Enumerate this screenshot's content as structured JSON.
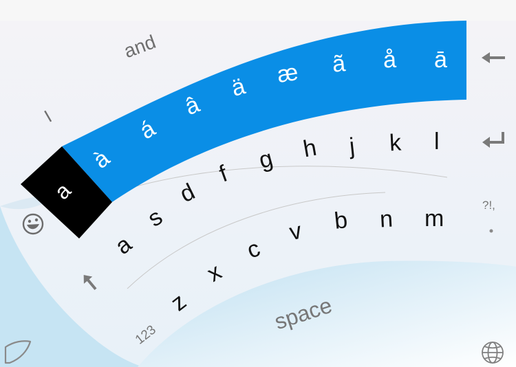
{
  "suggestions": [
    "I",
    "and"
  ],
  "accent_row": {
    "selected": "a",
    "keys": [
      "à",
      "á",
      "â",
      "ä",
      "æ",
      "ã",
      "å",
      "ā"
    ]
  },
  "row_top": [
    "l",
    "k",
    "j",
    "h",
    "g",
    "f",
    "d"
  ],
  "row_middle": [
    "a",
    "s",
    "b",
    "n",
    "m"
  ],
  "row_middle_inner": [
    "v",
    "c"
  ],
  "row_bottom": [
    "z",
    "x"
  ],
  "space_label": "space",
  "numbers_label": "123",
  "side": {
    "backspace_icon": "backspace-arrow-icon",
    "enter_icon": "enter-return-icon",
    "punct_label": "?!,",
    "period_label": "."
  },
  "colors": {
    "accent_blue": "#0a8ee6",
    "selected_black": "#000000",
    "background_blue": "#cfe8f5"
  }
}
